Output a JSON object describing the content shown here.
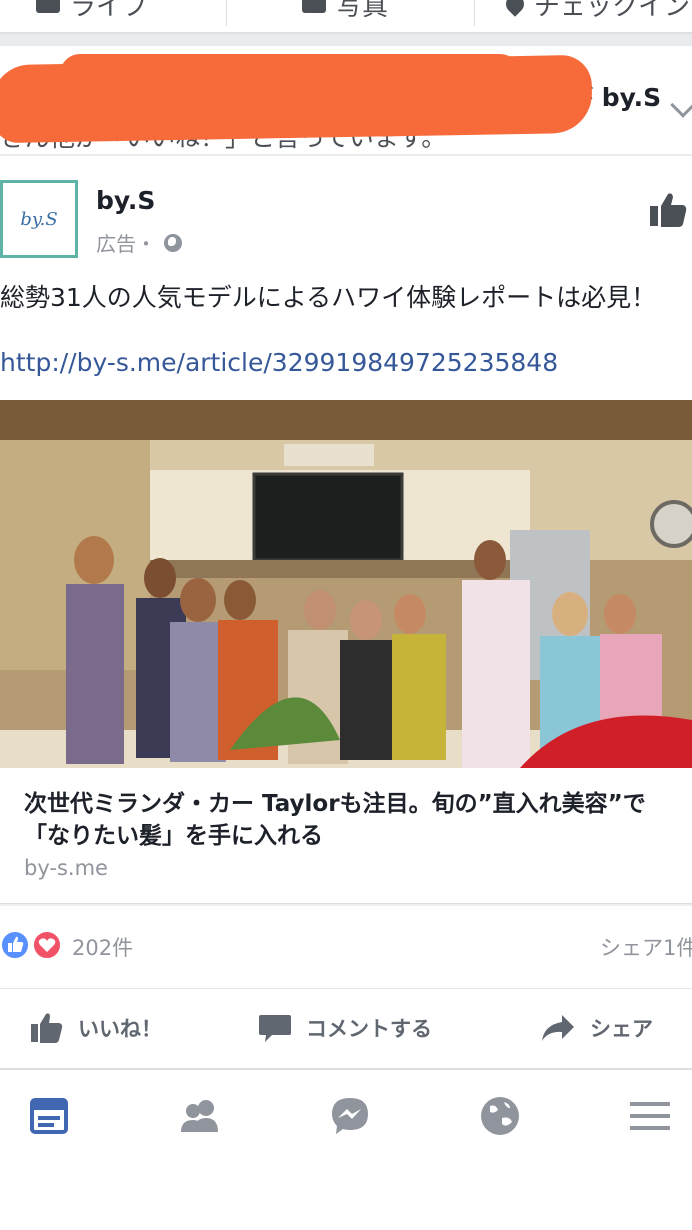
{
  "top_bar": {
    "items": [
      {
        "label": "ライブ",
        "icon": "video-icon"
      },
      {
        "label": "写真",
        "icon": "photo-icon"
      },
      {
        "label": "チェックイン",
        "icon": "location-pin-icon"
      }
    ]
  },
  "context": {
    "text": "さん他が「いいね！」と言っています。",
    "page": "が by.S"
  },
  "post": {
    "page_name": "by.S",
    "avatar_text": "by.S",
    "meta": "広告・",
    "body": "総勢31人の人気モデルによるハワイ体験レポートは必見！",
    "link": "http://by-s.me/article/329919849725235848"
  },
  "link_preview": {
    "headline": "次世代ミランダ・カー Taylorも注目。旬の”直入れ美容”で「なりたい髪」を手に入れる",
    "domain": "by-s.me"
  },
  "reactions": {
    "count": "202件",
    "shares": "シェア1件"
  },
  "actions": {
    "like": "いいね！",
    "comment": "コメントする",
    "share": "シェア"
  },
  "tabs": [
    "news-feed",
    "friends",
    "messenger",
    "notifications",
    "menu"
  ],
  "colors": {
    "brand_blue": "#365899",
    "active_tab": "#4267b2",
    "redaction": "#f76a3a",
    "like": "#5890ff",
    "love": "#f25268"
  }
}
